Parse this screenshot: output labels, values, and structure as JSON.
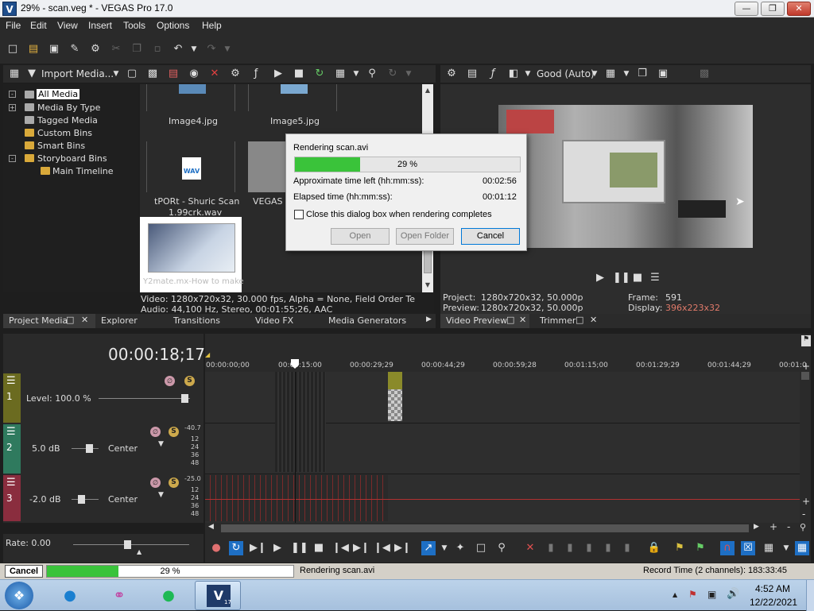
{
  "window": {
    "title": "29% - scan.veg * - VEGAS Pro 17.0",
    "app_icon_letter": "V"
  },
  "menu": [
    "File",
    "Edit",
    "View",
    "Insert",
    "Tools",
    "Options",
    "Help"
  ],
  "media_toolbar": {
    "import_label": "Import Media..."
  },
  "media_tree": [
    "All Media",
    "Media By Type",
    "Tagged Media",
    "Custom Bins",
    "Smart Bins",
    "Storyboard Bins",
    "Main Timeline"
  ],
  "media_items": {
    "image4": "Image4.jpg",
    "image5": "Image5.jpg",
    "wav_line1": "tPORt - Shuric Scan",
    "wav_line2": "1.99crk.wav",
    "vegas": "VEGAS S",
    "y2mate": "Y2mate.mx-How to make"
  },
  "media_info": {
    "video": "Video: 1280x720x32, 30.000 fps, Alpha = None, Field Order Te",
    "audio": "Audio: 44,100 Hz, Stereo, 00:01:55;26, AAC"
  },
  "preview_toolbar": {
    "quality": "Good (Auto)"
  },
  "preview_info": {
    "project_label": "Project:",
    "project_value": "1280x720x32, 50.000p",
    "preview_label": "Preview:",
    "preview_value": "1280x720x32, 50.000p",
    "frame_label": "Frame:",
    "frame_value": "591",
    "display_label": "Display:",
    "display_value": "396x223x32"
  },
  "left_tabs": [
    "Project Media",
    "Explorer",
    "Transitions",
    "Video FX",
    "Media Generators"
  ],
  "right_tabs": [
    "Video Preview",
    "Trimmer"
  ],
  "dialog": {
    "title": "Rendering scan.avi",
    "progress_label": "29 %",
    "progress": 0.29,
    "time_left_label": "Approximate time left (hh:mm:ss):",
    "time_left_value": "00:02:56",
    "elapsed_label": "Elapsed time (hh:mm:ss):",
    "elapsed_value": "00:01:12",
    "close_checkbox": "Close this dialog box when rendering completes",
    "open_btn": "Open",
    "open_folder_btn": "Open Folder",
    "cancel_btn": "Cancel"
  },
  "timeline": {
    "timecode": "00:00:18;17",
    "ruler": [
      "00:00:00;00",
      "00:00:15:00",
      "00:00:29;29",
      "00:00:44;29",
      "00:00:59;28",
      "00:01:15;00",
      "00:01:29;29",
      "00:01:44;29",
      "00:01:0"
    ],
    "tracks": [
      {
        "num": "1",
        "label": "Level: 100.0 %"
      },
      {
        "num": "2",
        "volume": "5.0 dB",
        "pan": "Center",
        "meter": [
          "-40.7",
          "12",
          "24",
          "36",
          "48"
        ]
      },
      {
        "num": "3",
        "volume": "-2.0 dB",
        "pan": "Center",
        "meter": [
          "-25.0",
          "12",
          "24",
          "36",
          "48"
        ]
      }
    ],
    "rate": "Rate: 0.00"
  },
  "statusbar": {
    "cancel": "Cancel",
    "progress_label": "29 %",
    "progress": 0.29,
    "task": "Rendering scan.avi",
    "record_time": "Record Time (2 channels): 183:33:45"
  },
  "taskbar": {
    "time": "4:52 AM",
    "date": "12/22/2021",
    "vegas_version": "17"
  },
  "colors": {
    "progress": "#3ac33a",
    "accent": "#1e6fc4",
    "track1": "#6b6b20",
    "track2": "#2f7a5e",
    "track3": "#8a2d3e",
    "display_value": "#e07a6a"
  }
}
